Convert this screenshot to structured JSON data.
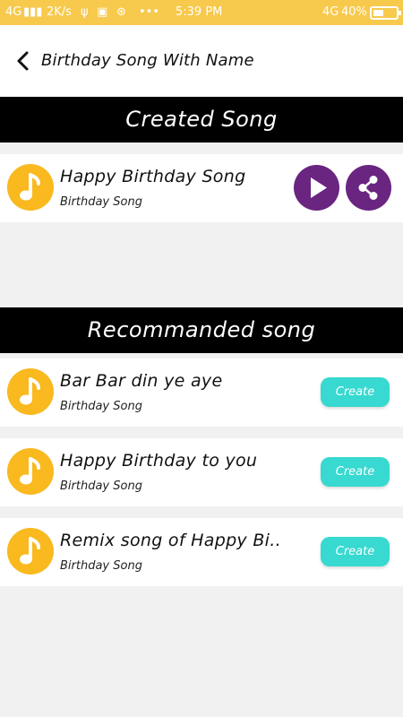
{
  "status_bar": {
    "network_left": "4G",
    "speed": "2K/s",
    "more": "•••",
    "time": "5:39 PM",
    "network_right": "4G",
    "battery": "40%"
  },
  "app_bar": {
    "title": "Birthday Song With Name"
  },
  "sections": {
    "created_title": "Created Song",
    "recommended_title": "Recommanded song"
  },
  "created_songs": [
    {
      "title": "Happy Birthday Song",
      "subtitle": "Birthday Song"
    }
  ],
  "recommended_songs": [
    {
      "title": "Bar Bar din ye aye",
      "subtitle": "Birthday Song",
      "button": "Create"
    },
    {
      "title": "Happy Birthday to you",
      "subtitle": "Birthday Song",
      "button": "Create"
    },
    {
      "title": "Remix song of Happy Bi..",
      "subtitle": "Birthday Song",
      "button": "Create"
    }
  ],
  "colors": {
    "status_bar": "#f7c94c",
    "note_icon_bg": "#f9b91f",
    "action_button": "#6a2580",
    "create_button": "#37d9d0",
    "section_header": "#000000"
  }
}
